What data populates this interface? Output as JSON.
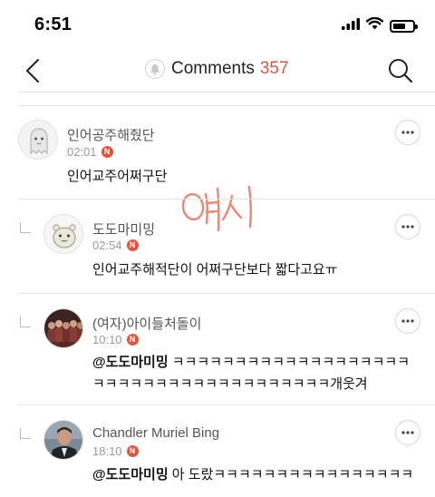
{
  "status": {
    "time": "6:51"
  },
  "header": {
    "title": "Comments",
    "count": "357"
  },
  "watermark_text": "여시",
  "comments": [
    {
      "author": "인어공주해줬단",
      "time": "02:01",
      "badge": "N",
      "text": "인어교주어쩌구단",
      "is_reply": false,
      "avatar": "ghost-avatar"
    },
    {
      "author": "도도마미밍",
      "time": "02:54",
      "badge": "N",
      "text": "인어교주해적단이 어쩌구단보다 짧다고요ㅠ",
      "is_reply": true,
      "avatar": "potato-avatar"
    },
    {
      "author": "(여자)아이들처돌이",
      "time": "10:10",
      "badge": "N",
      "mention": "@도도마미밍",
      "text": " ㅋㅋㅋㅋㅋㅋㅋㅋㅋㅋㅋㅋㅋㅋㅋㅋㅋㅋㅋㅋㅋㅋㅋㅋㅋㅋㅋㅋㅋㅋㅋㅋㅋㅋㅋㅋㅋㅋ개웃겨",
      "is_reply": true,
      "avatar": "group-photo-avatar"
    },
    {
      "author": "Chandler Muriel Bing",
      "time": "18:10",
      "badge": "N",
      "mention": "@도도마미밍",
      "text": " 아 도랐ㅋㅋㅋㅋㅋㅋㅋㅋㅋㅋㅋㅋㅋㅋㅋㅋ",
      "is_reply": true,
      "avatar": "man-photo-avatar"
    }
  ],
  "colors": {
    "accent": "#e2533e",
    "watermark": "#e8705d"
  }
}
